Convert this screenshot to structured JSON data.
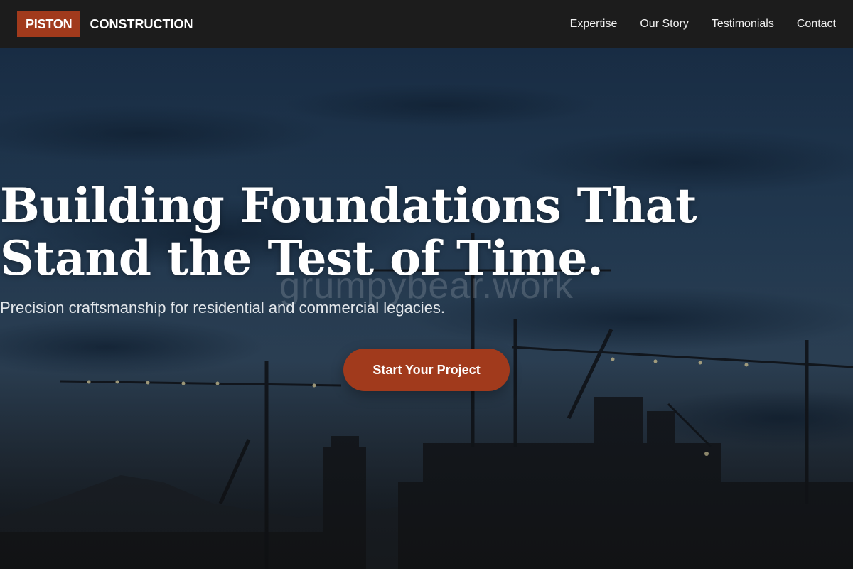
{
  "brand": {
    "logo_box_text": "PISTON",
    "logo_text": "CONSTRUCTION",
    "accent_color": "#a13a1c"
  },
  "nav": {
    "items": [
      {
        "label": "Expertise"
      },
      {
        "label": "Our Story"
      },
      {
        "label": "Testimonials"
      },
      {
        "label": "Contact"
      }
    ]
  },
  "hero": {
    "title_line1": "Building Foundations That",
    "title_line2": "Stand the Test of Time.",
    "subtitle": "Precision craftsmanship for residential and commercial legacies.",
    "cta_label": "Start Your Project",
    "watermark": "grumpybear.work"
  }
}
